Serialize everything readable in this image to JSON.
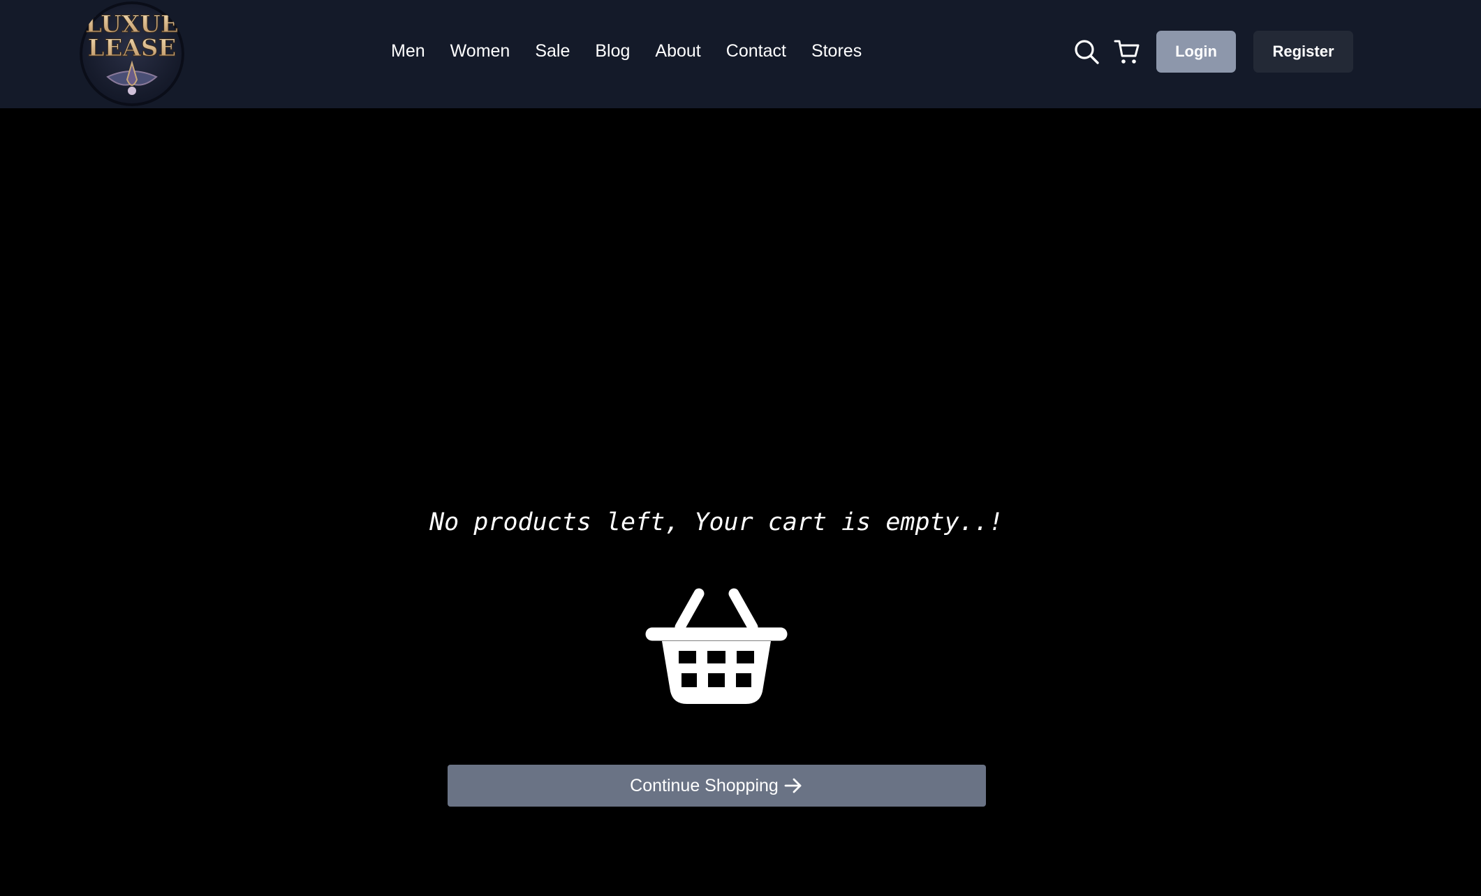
{
  "brand": {
    "logo_line1": "LUXUE",
    "logo_line2": "LEASE"
  },
  "nav": {
    "links": [
      {
        "label": "Men"
      },
      {
        "label": "Women"
      },
      {
        "label": "Sale"
      },
      {
        "label": "Blog"
      },
      {
        "label": "About"
      },
      {
        "label": "Contact"
      },
      {
        "label": "Stores"
      }
    ]
  },
  "header": {
    "search_icon": "search-icon",
    "cart_icon": "cart-icon",
    "login_label": "Login",
    "register_label": "Register"
  },
  "cart": {
    "empty_message": "No products left, Your cart is empty..!",
    "basket_icon": "basket-icon",
    "continue_label": "Continue Shopping",
    "continue_icon": "arrow-right-icon"
  },
  "colors": {
    "page_background": "#000000",
    "navbar_background": "#141a29",
    "login_button": "#8d97ab",
    "register_button": "#232936",
    "continue_button": "#6a7385",
    "logo_gold": "#d9b98a"
  }
}
